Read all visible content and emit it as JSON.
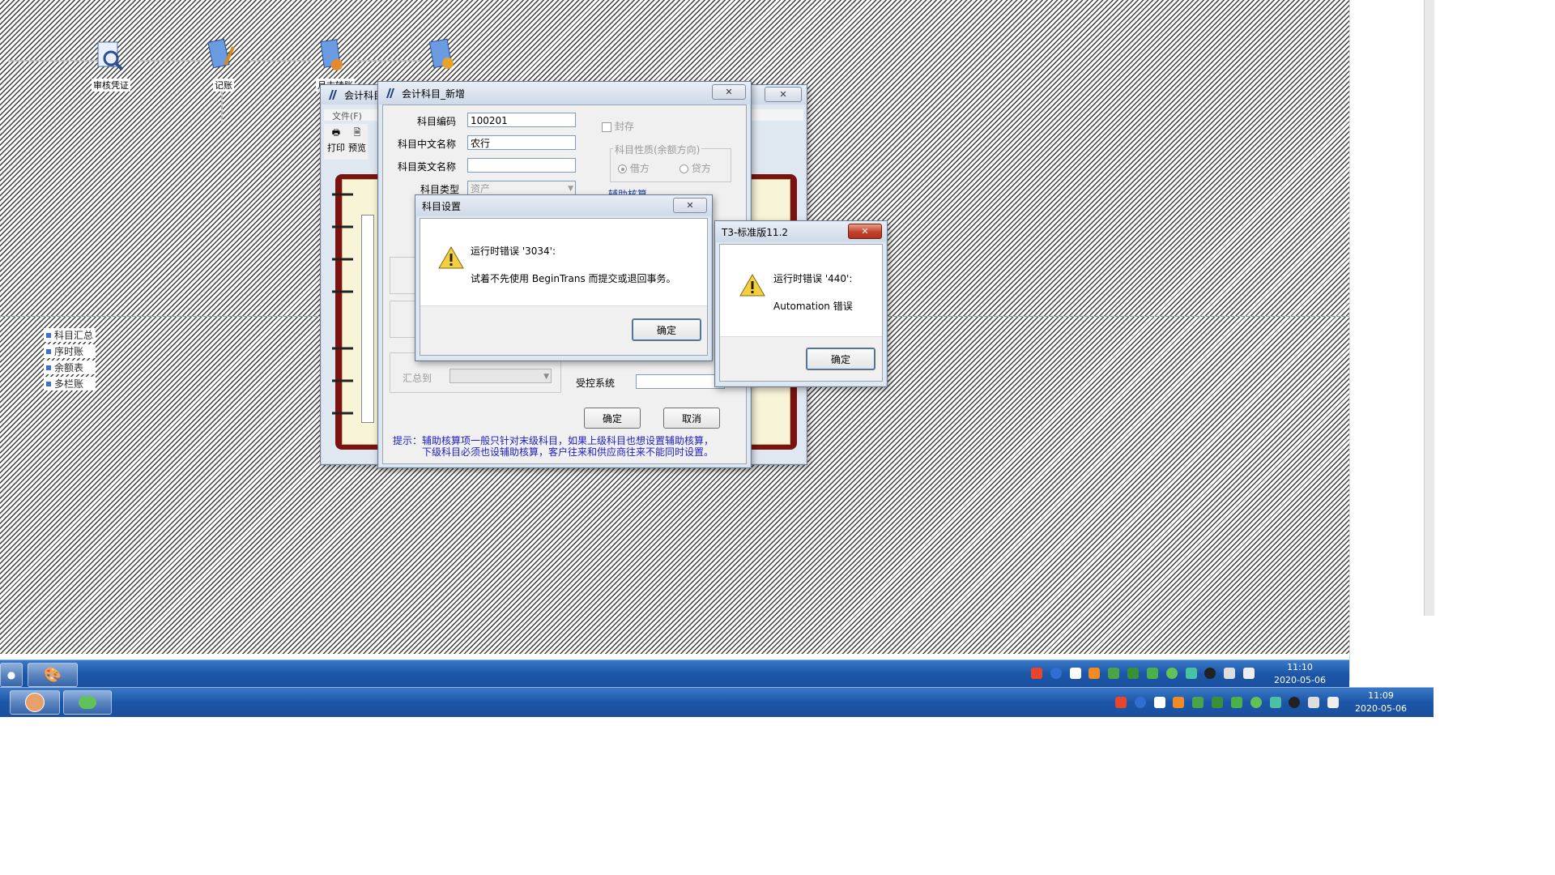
{
  "workflow": {
    "nodes": [
      {
        "label": "审核凭证"
      },
      {
        "label": "记账"
      },
      {
        "label": "月末转账"
      }
    ]
  },
  "left_links": [
    {
      "label": "科目汇总"
    },
    {
      "label": "序时账"
    },
    {
      "label": "余额表"
    },
    {
      "label": "多栏账"
    }
  ],
  "bg_window": {
    "title": "会计科目",
    "menu": [
      "文件(F)"
    ],
    "toolbar": [
      "打印",
      "预览"
    ]
  },
  "add_account": {
    "title": "会计科目_新增",
    "code_label": "科目编码",
    "code_value": "100201",
    "cn_name_label": "科目中文名称",
    "cn_name_value": "农行",
    "en_name_label": "科目英文名称",
    "en_name_value": "",
    "type_label": "科目类型",
    "type_value": "资产",
    "sealed_label": "封存",
    "nature_legend": "科目性质(余额方向)",
    "debit_label": "借方",
    "credit_label": "贷方",
    "aux_legend": "辅助核算",
    "summary_label": "汇总到",
    "controlled_label": "受控系统",
    "ok_label": "确定",
    "cancel_label": "取消",
    "tip_line1": "提示：辅助核算项一般只针对末级科目，如果上级科目也想设置辅助核算，",
    "tip_line2": "下级科目必须也设辅助核算，客户往来和供应商往来不能同时设置。"
  },
  "error_3034": {
    "title": "科目设置",
    "message_line1": "运行时错误 '3034':",
    "message_line2": "试着不先使用 BeginTrans 而提交或退回事务。",
    "ok_label": "确定"
  },
  "error_440": {
    "title": "T3-标准版11.2",
    "message_line1": "运行时错误 '440':",
    "message_line2": "Automation 错误",
    "ok_label": "确定"
  },
  "taskbar_top": {
    "time": "11:10",
    "date": "2020-05-06"
  },
  "taskbar_bottom": {
    "time": "11:09",
    "date": "2020-05-06"
  },
  "colors": {
    "tip_text": "#2020c0",
    "taskbar": "#1c56a8"
  }
}
